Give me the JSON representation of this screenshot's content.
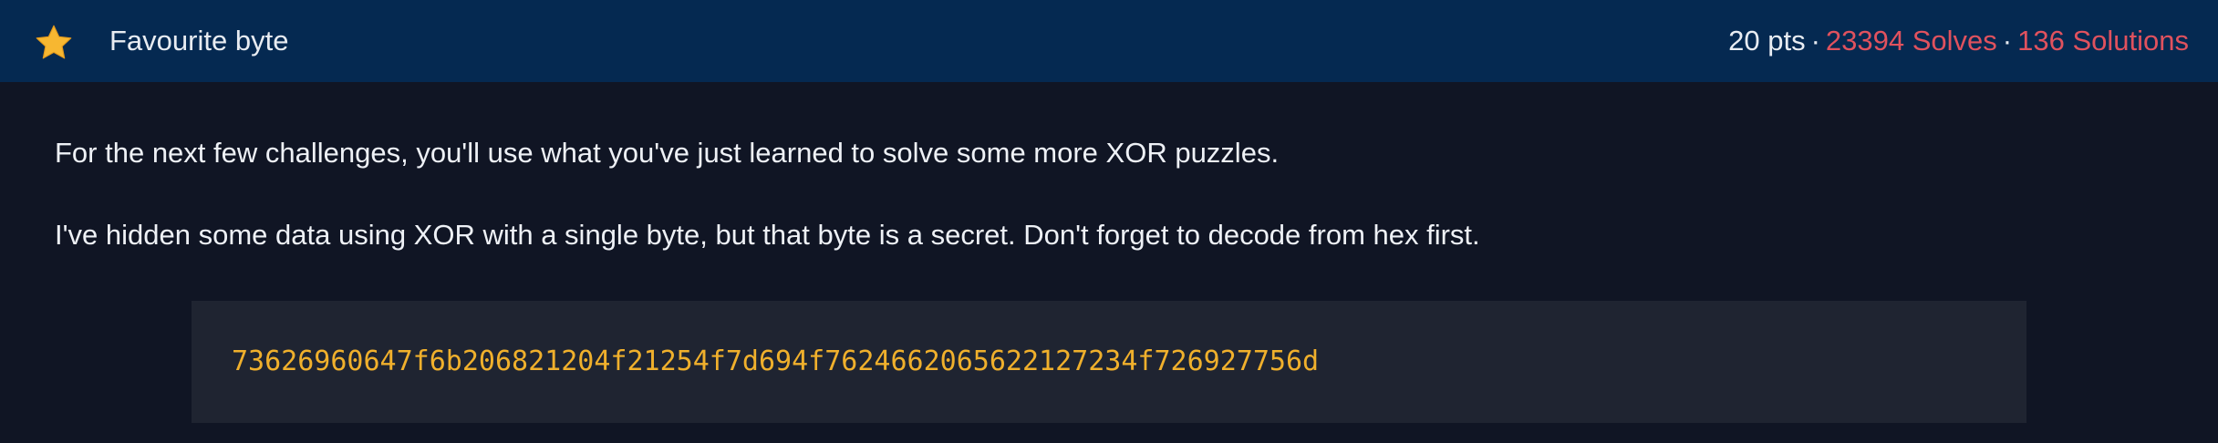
{
  "header": {
    "icon": "star-icon",
    "title": "Favourite byte",
    "points": "20 pts",
    "separator": "·",
    "solves": "23394 Solves",
    "solutions": "136 Solutions"
  },
  "challenge": {
    "paragraph1": "For the next few challenges, you'll use what you've just learned to solve some more XOR puzzles.",
    "paragraph2": "I've hidden some data using XOR with a single byte, but that byte is a secret. Don't forget to decode from hex first.",
    "ciphertext": "73626960647f6b206821204f21254f7d694f7624662065622127234f726927756d"
  },
  "colors": {
    "header_bg": "#052951",
    "page_bg": "#101524",
    "accent_red": "#e0525e",
    "code_text": "#f0b02c",
    "code_bg": "#1f2431",
    "star": "#f7b731"
  }
}
